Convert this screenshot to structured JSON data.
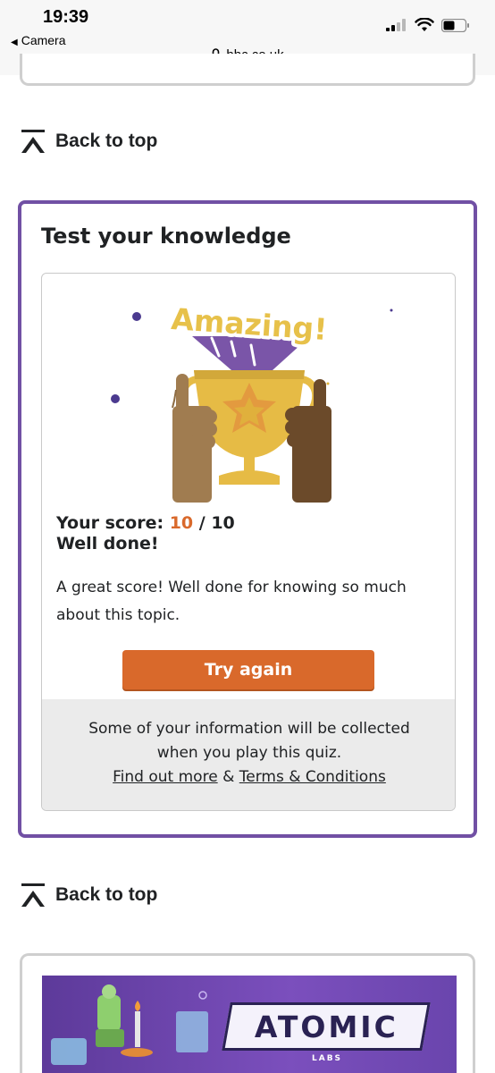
{
  "status_bar": {
    "time": "19:39",
    "back_app": "Camera",
    "url": "bbc.co.uk"
  },
  "back_to_top": "Back to top",
  "quiz": {
    "title": "Test your knowledge",
    "illustration_text": "Amazing!",
    "score_label": "Your score:",
    "score_value": "10",
    "score_total": "/ 10",
    "score_message": "Well done!",
    "description": "A great score! Well done for knowing so much about this topic.",
    "try_again_label": "Try again",
    "info_text_line1": "Some of your information will be collected",
    "info_text_line2": "when you play this quiz.",
    "find_out_more": "Find out more",
    "ampersand": "&",
    "terms": "Terms & Conditions"
  },
  "banner": {
    "logo_text": "ATOMIC",
    "sub_text": "LABS"
  },
  "colors": {
    "accent_purple": "#7150a4",
    "accent_orange": "#d9692b"
  },
  "icons": [
    "wifi-icon",
    "signal-icon",
    "battery-icon",
    "lock-icon",
    "back-to-top-icon",
    "trophy-illustration"
  ]
}
